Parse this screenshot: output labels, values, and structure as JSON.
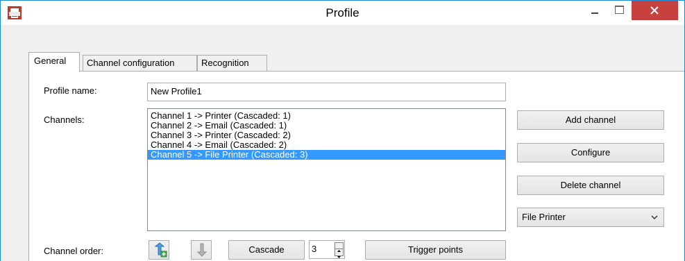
{
  "window": {
    "title": "Profile",
    "icon": "printer-app-icon",
    "controls": {
      "minimize": "minimize-icon",
      "maximize": "maximize-icon",
      "close": "close-icon"
    },
    "close_color": "#c7423f",
    "border_color": "#1e8ad6"
  },
  "tabs": [
    {
      "label": "General",
      "active": true
    },
    {
      "label": "Channel configuration",
      "active": false
    },
    {
      "label": "Recognition",
      "active": false
    }
  ],
  "general": {
    "profile_name_label": "Profile name:",
    "profile_name_value": "New Profile1",
    "channels_label": "Channels:",
    "channels": [
      "Channel 1 -> Printer (Cascaded: 1)",
      "Channel 2 -> Email (Cascaded: 1)",
      "Channel 3 -> Printer (Cascaded: 2)",
      "Channel 4 -> Email (Cascaded: 2)",
      "Channel 5 -> File Printer (Cascaded: 3)"
    ],
    "selected_channel_index": 4,
    "selection_color": "#3399ff",
    "add_channel_label": "Add channel",
    "configure_label": "Configure",
    "delete_channel_label": "Delete channel",
    "channel_type_selected": "File Printer",
    "channel_order_label": "Channel order:",
    "move_up_icon": "move-up-arrow-icon",
    "move_down_icon": "move-down-arrow-icon",
    "cascade_label": "Cascade",
    "cascade_value": "3",
    "trigger_points_label": "Trigger points"
  }
}
